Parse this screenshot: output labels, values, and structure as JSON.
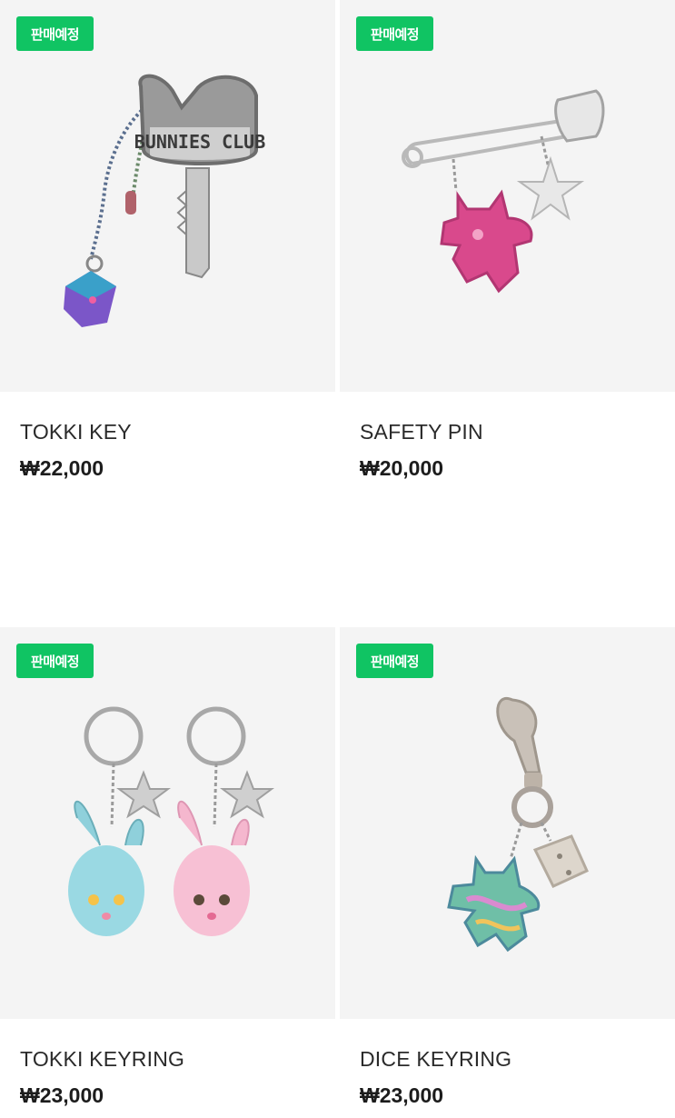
{
  "products": [
    {
      "badge": "판매예정",
      "name": "TOKKI KEY",
      "price": "₩22,000",
      "image_label": "BUNNIES CLUB"
    },
    {
      "badge": "판매예정",
      "name": "SAFETY PIN",
      "price": "₩20,000"
    },
    {
      "badge": "판매예정",
      "name": "TOKKI KEYRING",
      "price": "₩23,000"
    },
    {
      "badge": "판매예정",
      "name": "DICE KEYRING",
      "price": "₩23,000"
    }
  ],
  "colors": {
    "badge_bg": "#10c463",
    "image_bg": "#f4f4f4"
  }
}
